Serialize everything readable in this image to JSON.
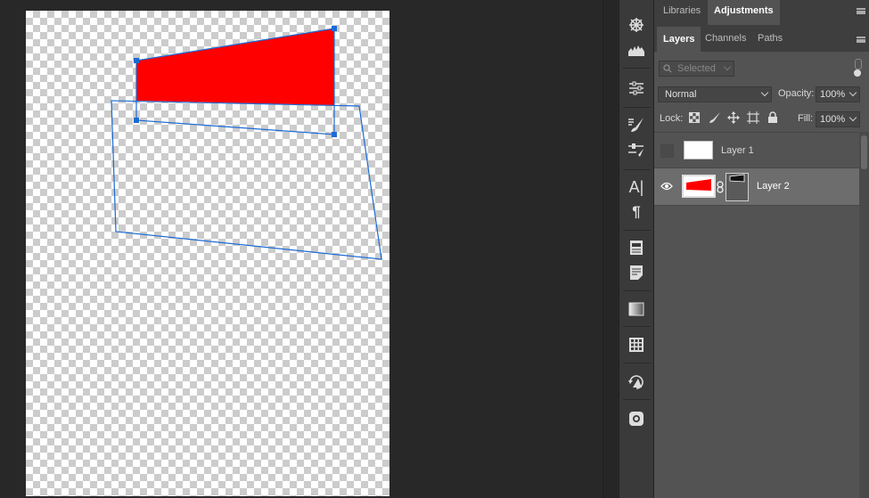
{
  "document": {
    "transform_handles": "visible"
  },
  "tools": [
    {
      "name": "3d-axis-icon"
    },
    {
      "name": "histogram-icon"
    },
    {
      "name": "adjustments-sliders-icon"
    },
    {
      "name": "brush-settings-icon"
    },
    {
      "name": "tool-presets-icon"
    },
    {
      "name": "character-icon",
      "glyph": "A|"
    },
    {
      "name": "paragraph-icon",
      "glyph": "¶"
    },
    {
      "name": "properties-icon"
    },
    {
      "name": "notes-icon"
    },
    {
      "name": "gradient-icon"
    },
    {
      "name": "swatches-icon"
    },
    {
      "name": "history-icon"
    },
    {
      "name": "instagram-icon"
    }
  ],
  "panels": {
    "top_tabs": [
      {
        "label": "Libraries",
        "active": false
      },
      {
        "label": "Adjustments",
        "active": true
      }
    ],
    "layer_tabs": [
      {
        "label": "Layers",
        "active": true
      },
      {
        "label": "Channels",
        "active": false
      },
      {
        "label": "Paths",
        "active": false
      }
    ],
    "filter": {
      "value": "Selected"
    },
    "blend_mode": "Normal",
    "opacity_label": "Opacity:",
    "opacity_value": "100%",
    "lock_label": "Lock:",
    "fill_label": "Fill:",
    "fill_value": "100%",
    "layers": [
      {
        "name": "Layer 1",
        "visible": false,
        "selected": false
      },
      {
        "name": "Layer 2",
        "visible": true,
        "selected": true
      }
    ]
  },
  "colors": {
    "shape_fill": "#ff0000",
    "transform_box": "#1b6bd6"
  }
}
